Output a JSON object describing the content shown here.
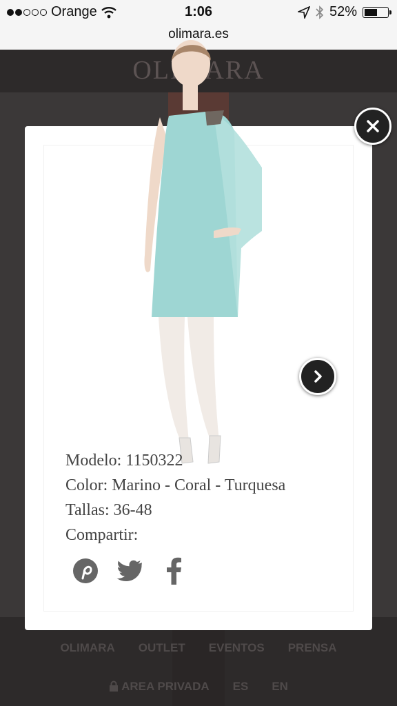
{
  "status_bar": {
    "carrier": "Orange",
    "time": "1:06",
    "battery_percent": "52%"
  },
  "browser": {
    "url": "olimara.es"
  },
  "site": {
    "logo": "OLIMARA",
    "footer_nav": [
      "OLIMARA",
      "OUTLET",
      "EVENTOS",
      "PRENSA"
    ],
    "footer_nav_secondary": [
      "AREA PRIVADA",
      "ES",
      "EN"
    ]
  },
  "modal": {
    "model_line": "Modelo: 1150322",
    "color_line": "Color: Marino - Coral - Turquesa",
    "sizes_line": "Tallas: 36-48",
    "share_label": "Compartir:",
    "share_icons": [
      "pinterest-icon",
      "twitter-icon",
      "facebook-icon"
    ]
  },
  "colors": {
    "dress": "#9ed6d3",
    "icons": "#666666",
    "overlay": "#3b3838"
  }
}
